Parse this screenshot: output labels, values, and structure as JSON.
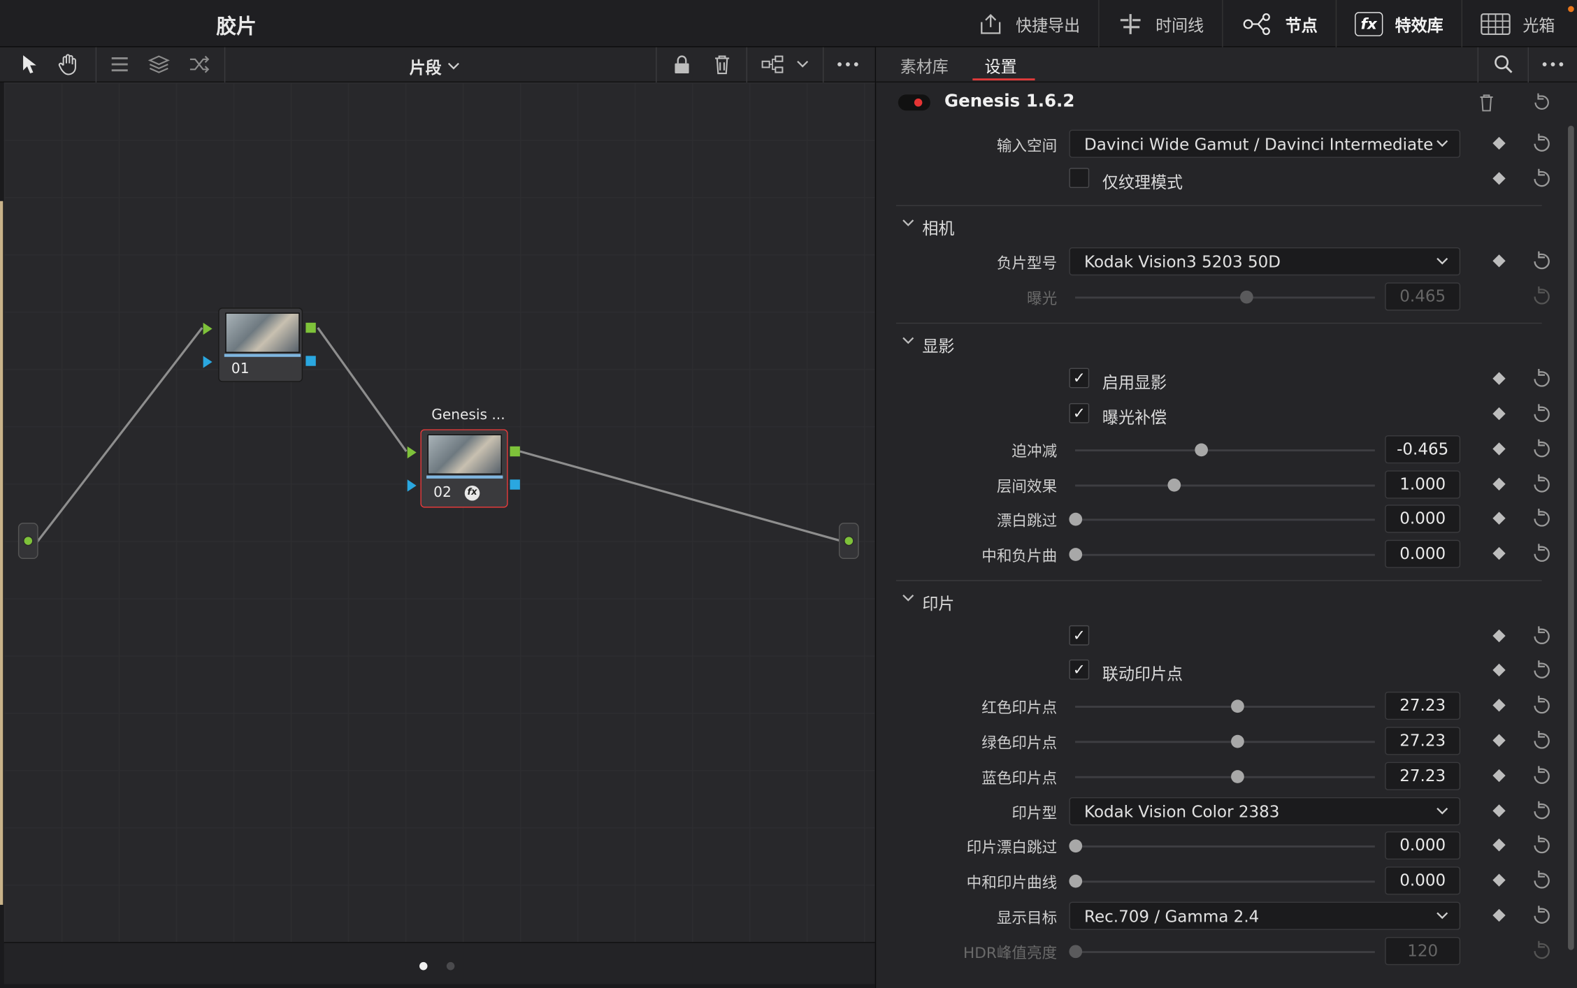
{
  "app": {
    "title": "胶片"
  },
  "topnav": {
    "quick_export": "快捷导出",
    "timeline": "时间线",
    "nodes": "节点",
    "effects": "特效库",
    "lightbox": "光箱",
    "fx_mark": "fx"
  },
  "node_toolbar": {
    "segment_label": "片段"
  },
  "nodes": {
    "n1": {
      "number": "01"
    },
    "n2": {
      "number": "02",
      "title": "Genesis ..."
    }
  },
  "right_panel": {
    "tabs": [
      "素材库",
      "设置"
    ],
    "effect_name": "Genesis 1.6.2",
    "input_space_label": "输入空间",
    "input_space_value": "Davinci Wide Gamut / Davinci Intermediate",
    "texture_only_label": "仅纹理模式",
    "camera_section": "相机",
    "negative_label": "负片型号",
    "negative_value": "Kodak Vision3 5203 50D",
    "exposure_label": "曝光",
    "exposure_value": "0.465",
    "develop_section": "显影",
    "enable_develop_label": "启用显影",
    "exposure_comp_label": "曝光补偿",
    "push_pull_label": "迫冲减",
    "push_pull_value": "-0.465",
    "interlayer_label": "层间效果",
    "interlayer_value": "1.000",
    "bleach_label": "漂白跳过",
    "bleach_value": "0.000",
    "neutral_neg_label": "中和负片曲",
    "neutral_neg_value": "0.000",
    "print_section": "印片",
    "link_points_label": "联动印片点",
    "red_label": "红色印片点",
    "red_value": "27.23",
    "green_label": "绿色印片点",
    "green_value": "27.23",
    "blue_label": "蓝色印片点",
    "blue_value": "27.23",
    "print_type_label": "印片型",
    "print_type_value": "Kodak Vision Color 2383",
    "print_bleach_label": "印片漂白跳过",
    "print_bleach_value": "0.000",
    "neutral_print_label": "中和印片曲线",
    "neutral_print_value": "0.000",
    "display_target_label": "显示目标",
    "display_target_value": "Rec.709 / Gamma 2.4",
    "hdr_peak_label": "HDR峰值亮度",
    "hdr_peak_value": "120"
  },
  "slider_levels": {
    "exposure": 0.57,
    "push_pull": 0.42,
    "interlayer": 0.33,
    "bleach": 0.0,
    "neutral_neg": 0.0,
    "red": 0.54,
    "green": 0.54,
    "blue": 0.54,
    "print_bleach": 0.0,
    "neutral_print": 0.0,
    "hdr_peak": 0.0
  },
  "colors": {
    "accent_red": "#e23b3b",
    "port_green": "#7ec23a",
    "port_blue": "#2aa7e0"
  }
}
